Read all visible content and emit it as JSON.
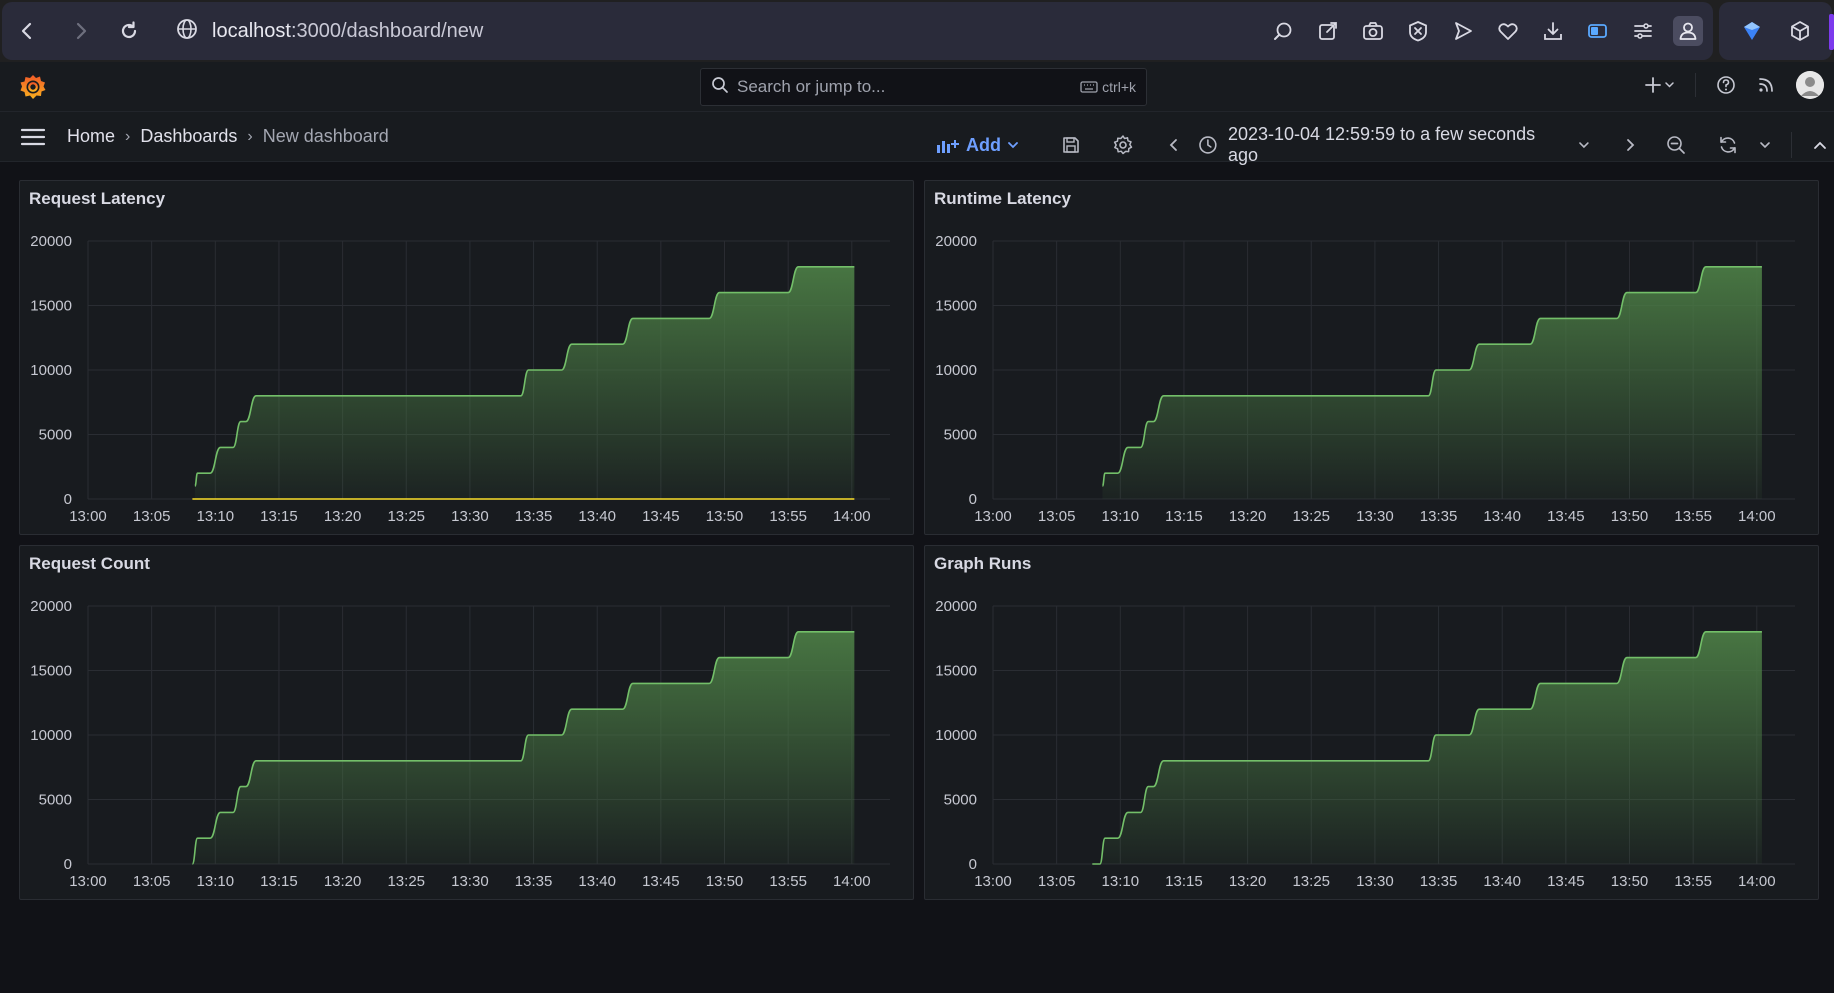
{
  "browser": {
    "url_host": "localhost",
    "url_path": ":3000/dashboard/new",
    "nav": [
      "back-icon",
      "forward-icon",
      "reload-icon",
      "globe-icon"
    ],
    "toolbar_icons": [
      "zoom-icon",
      "share-icon",
      "camera-icon",
      "block-icon",
      "send-icon",
      "heart-icon",
      "download-icon",
      "battery-icon",
      "menu-icon",
      "profile-icon"
    ],
    "extension_icons": [
      "shield-icon",
      "cube-icon"
    ],
    "accent_color": "#7c3aed"
  },
  "grafana": {
    "search": {
      "placeholder": "Search or jump to...",
      "shortcut": "ctrl+k"
    },
    "breadcrumbs": [
      "Home",
      "Dashboards",
      "New dashboard"
    ],
    "toolbar": {
      "add_label": "Add",
      "time_range": "2023-10-04 12:59:59 to a few seconds ago"
    },
    "colors": {
      "accent": "#6e9fff",
      "series_line": "#73bf69",
      "series_fill": "#4a7a44"
    }
  },
  "panels": [
    {
      "title": "Request Latency"
    },
    {
      "title": "Runtime Latency"
    },
    {
      "title": "Request Count"
    },
    {
      "title": "Graph Runs"
    }
  ],
  "chart_data": [
    {
      "type": "area",
      "title": "Request Latency",
      "x_ticks": [
        "13:00",
        "13:05",
        "13:10",
        "13:15",
        "13:20",
        "13:25",
        "13:30",
        "13:35",
        "13:40",
        "13:45",
        "13:50",
        "13:55",
        "14:00"
      ],
      "y_ticks": [
        0,
        5000,
        10000,
        15000,
        20000
      ],
      "ylim": [
        0,
        20000
      ],
      "x_minutes": [
        8.4,
        8.6,
        9.6,
        10.4,
        11.4,
        12.0,
        12.4,
        13.2,
        34.0,
        34.6,
        37.2,
        38.0,
        42.0,
        42.8,
        48.8,
        49.6,
        55.0,
        55.8,
        60.2
      ],
      "values": [
        1000,
        2000,
        2000,
        4000,
        4000,
        6000,
        6000,
        8000,
        8000,
        10000,
        10000,
        12000,
        12000,
        14000,
        14000,
        16000,
        16000,
        18000,
        18000
      ],
      "baseline_series": {
        "from_minute": 8.2,
        "to_minute": 60.2,
        "value": 0
      },
      "grid": true
    },
    {
      "type": "area",
      "title": "Runtime Latency",
      "x_ticks": [
        "13:00",
        "13:05",
        "13:10",
        "13:15",
        "13:20",
        "13:25",
        "13:30",
        "13:35",
        "13:40",
        "13:45",
        "13:50",
        "13:55",
        "14:00"
      ],
      "y_ticks": [
        0,
        5000,
        10000,
        15000,
        20000
      ],
      "ylim": [
        0,
        20000
      ],
      "x_minutes": [
        8.6,
        8.8,
        9.8,
        10.6,
        11.6,
        12.2,
        12.6,
        13.4,
        34.2,
        34.8,
        37.4,
        38.2,
        42.2,
        43.0,
        49.0,
        49.8,
        55.2,
        56.0,
        60.4
      ],
      "values": [
        1000,
        2000,
        2000,
        4000,
        4000,
        6000,
        6000,
        8000,
        8000,
        10000,
        10000,
        12000,
        12000,
        14000,
        14000,
        16000,
        16000,
        18000,
        18000
      ],
      "grid": true
    },
    {
      "type": "area",
      "title": "Request Count",
      "x_ticks": [
        "13:00",
        "13:05",
        "13:10",
        "13:15",
        "13:20",
        "13:25",
        "13:30",
        "13:35",
        "13:40",
        "13:45",
        "13:50",
        "13:55",
        "14:00"
      ],
      "y_ticks": [
        0,
        5000,
        10000,
        15000,
        20000
      ],
      "ylim": [
        0,
        20000
      ],
      "x_minutes": [
        8.2,
        8.6,
        9.6,
        10.4,
        11.4,
        12.0,
        12.4,
        13.2,
        34.0,
        34.6,
        37.2,
        38.0,
        42.0,
        42.8,
        48.8,
        49.6,
        55.0,
        55.8,
        60.2
      ],
      "values": [
        0,
        2000,
        2000,
        4000,
        4000,
        6000,
        6000,
        8000,
        8000,
        10000,
        10000,
        12000,
        12000,
        14000,
        14000,
        16000,
        16000,
        18000,
        18000
      ],
      "grid": true
    },
    {
      "type": "area",
      "title": "Graph Runs",
      "x_ticks": [
        "13:00",
        "13:05",
        "13:10",
        "13:15",
        "13:20",
        "13:25",
        "13:30",
        "13:35",
        "13:40",
        "13:45",
        "13:50",
        "13:55",
        "14:00"
      ],
      "y_ticks": [
        0,
        5000,
        10000,
        15000,
        20000
      ],
      "ylim": [
        0,
        20000
      ],
      "x_minutes": [
        7.8,
        8.4,
        8.8,
        9.8,
        10.6,
        11.6,
        12.2,
        12.6,
        13.4,
        34.2,
        34.8,
        37.4,
        38.2,
        42.2,
        43.0,
        49.0,
        49.8,
        55.2,
        56.0,
        60.4
      ],
      "values": [
        0,
        0,
        2000,
        2000,
        4000,
        4000,
        6000,
        6000,
        8000,
        8000,
        10000,
        10000,
        12000,
        12000,
        14000,
        14000,
        16000,
        16000,
        18000,
        18000
      ],
      "grid": true
    }
  ]
}
